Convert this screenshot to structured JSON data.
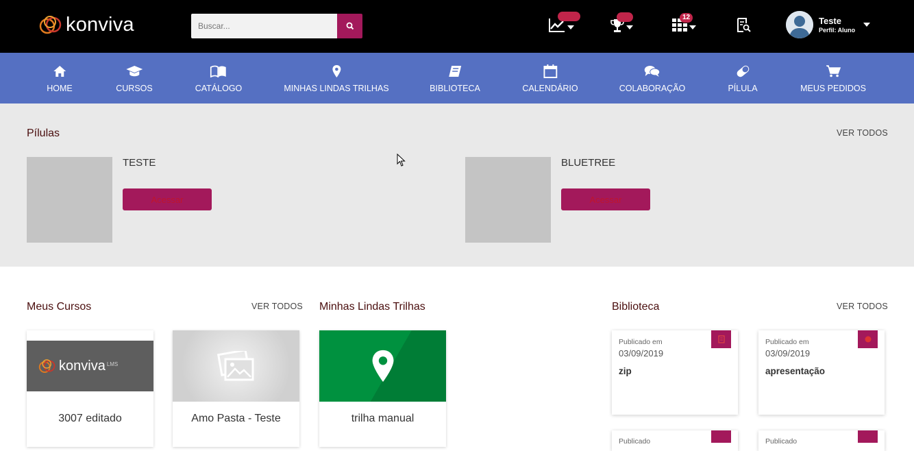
{
  "header": {
    "logo_text": "konviva",
    "search_placeholder": "Buscar...",
    "badges": {
      "notifications": "12"
    },
    "user": {
      "name": "Teste",
      "profile": "Perfil: Aluno"
    }
  },
  "nav": {
    "items": [
      {
        "label": "HOME",
        "icon": "home-icon"
      },
      {
        "label": "CURSOS",
        "icon": "graduation-cap-icon"
      },
      {
        "label": "CATÁLOGO",
        "icon": "open-book-icon"
      },
      {
        "label": "MINHAS LINDAS TRILHAS",
        "icon": "map-pin-icon"
      },
      {
        "label": "BIBLIOTECA",
        "icon": "library-book-icon"
      },
      {
        "label": "CALENDÁRIO",
        "icon": "calendar-icon"
      },
      {
        "label": "COLABORAÇÃO",
        "icon": "chat-bubbles-icon"
      },
      {
        "label": "PÍLULA",
        "icon": "pill-icon"
      },
      {
        "label": "MEUS PEDIDOS",
        "icon": "cart-icon"
      }
    ]
  },
  "pilulas": {
    "title": "Pílulas",
    "ver_todos": "VER TODOS",
    "items": [
      {
        "name": "TESTE",
        "button": "Acessar"
      },
      {
        "name": "BLUETREE",
        "button": "Acessar"
      }
    ]
  },
  "meus_cursos": {
    "title": "Meus Cursos",
    "ver_todos": "VER TODOS",
    "items": [
      {
        "name": "3007 editado",
        "thumb_logo": "konviva",
        "thumb_logo_suffix": "LMS"
      },
      {
        "name": "Amo Pasta - Teste"
      }
    ]
  },
  "trilhas": {
    "title": "Minhas Lindas Trilhas",
    "items": [
      {
        "name": "trilha manual"
      }
    ]
  },
  "biblioteca": {
    "title": "Biblioteca",
    "ver_todos": "VER TODOS",
    "items": [
      {
        "published_label": "Publicado em",
        "date": "03/09/2019",
        "title": "zip"
      },
      {
        "published_label": "Publicado em",
        "date": "03/09/2019",
        "title": "apresentação"
      }
    ],
    "partial_label": "Publicado"
  },
  "colors": {
    "accent": "#a3195b",
    "nav": "#5570c2",
    "topbar": "#000000",
    "trilha_green": "#00913f"
  }
}
